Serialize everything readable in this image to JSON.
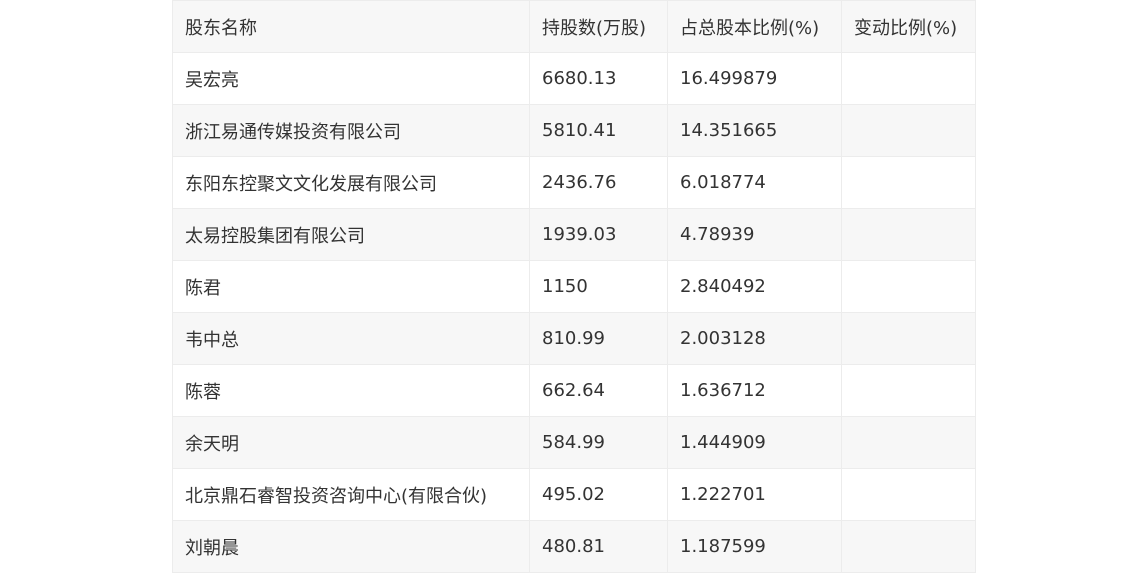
{
  "table": {
    "headers": [
      "股东名称",
      "持股数(万股)",
      "占总股本比例(%)",
      "变动比例(%)"
    ],
    "rows": [
      [
        "吴宏亮",
        "6680.13",
        "16.499879",
        ""
      ],
      [
        "浙江易通传媒投资有限公司",
        "5810.41",
        "14.351665",
        ""
      ],
      [
        "东阳东控聚文文化发展有限公司",
        "2436.76",
        "6.018774",
        ""
      ],
      [
        "太易控股集团有限公司",
        "1939.03",
        "4.78939",
        ""
      ],
      [
        "陈君",
        "1150",
        "2.840492",
        ""
      ],
      [
        "韦中总",
        "810.99",
        "2.003128",
        ""
      ],
      [
        "陈蓉",
        "662.64",
        "1.636712",
        ""
      ],
      [
        "余天明",
        "584.99",
        "1.444909",
        ""
      ],
      [
        "北京鼎石睿智投资咨询中心(有限合伙)",
        "495.02",
        "1.222701",
        ""
      ],
      [
        "刘朝晨",
        "480.81",
        "1.187599",
        ""
      ]
    ]
  }
}
